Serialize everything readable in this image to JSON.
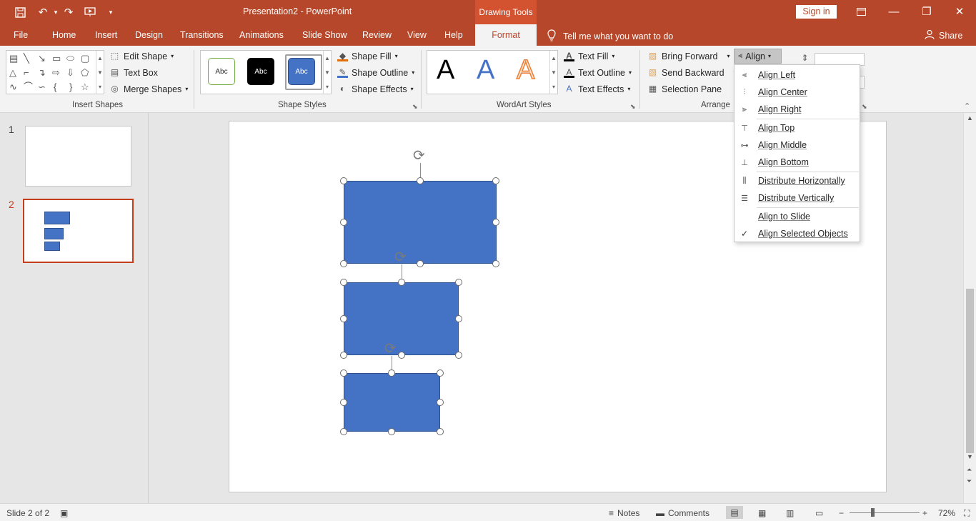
{
  "titlebar": {
    "doc_title": "Presentation2  -  PowerPoint",
    "contextual_tab_group": "Drawing Tools",
    "sign_in": "Sign in"
  },
  "tabs": {
    "file": "File",
    "home": "Home",
    "insert": "Insert",
    "design": "Design",
    "transitions": "Transitions",
    "animations": "Animations",
    "slide_show": "Slide Show",
    "review": "Review",
    "view": "View",
    "help": "Help",
    "format": "Format",
    "tell_me": "Tell me what you want to do",
    "share": "Share"
  },
  "ribbon": {
    "insert_shapes": {
      "label": "Insert Shapes",
      "edit_shape": "Edit Shape",
      "text_box": "Text Box",
      "merge_shapes": "Merge Shapes"
    },
    "shape_styles": {
      "label": "Shape Styles",
      "thumbs": [
        "Abc",
        "Abc",
        "Abc"
      ],
      "shape_fill": "Shape Fill",
      "shape_outline": "Shape Outline",
      "shape_effects": "Shape Effects"
    },
    "wordart_styles": {
      "label": "WordArt Styles",
      "letters": [
        "A",
        "A",
        "A"
      ],
      "text_fill": "Text Fill",
      "text_outline": "Text Outline",
      "text_effects": "Text Effects"
    },
    "arrange": {
      "label": "Arrange",
      "bring_forward": "Bring Forward",
      "send_backward": "Send Backward",
      "selection_pane": "Selection Pane",
      "align": "Align"
    }
  },
  "align_menu": [
    {
      "label": "Align Left",
      "icon": "align-left-icon"
    },
    {
      "label": "Align Center",
      "icon": "align-center-icon"
    },
    {
      "label": "Align Right",
      "icon": "align-right-icon"
    },
    {
      "label": "Align Top",
      "icon": "align-top-icon"
    },
    {
      "label": "Align Middle",
      "icon": "align-middle-icon"
    },
    {
      "label": "Align Bottom",
      "icon": "align-bottom-icon"
    },
    {
      "label": "Distribute Horizontally",
      "icon": "distribute-horizontally-icon"
    },
    {
      "label": "Distribute Vertically",
      "icon": "distribute-vertically-icon"
    },
    {
      "label": "Align to Slide",
      "icon": ""
    },
    {
      "label": "Align Selected Objects",
      "icon": "checkmark-icon",
      "checked": true
    }
  ],
  "slides": [
    {
      "number": "1"
    },
    {
      "number": "2",
      "selected": true
    }
  ],
  "statusbar": {
    "slide_info": "Slide 2 of 2",
    "notes": "Notes",
    "comments": "Comments",
    "zoom": "72%"
  },
  "colors": {
    "accent": "#b7472a",
    "shape_fill": "#4472c4",
    "selected_thumb_border": "#c43e1c"
  }
}
